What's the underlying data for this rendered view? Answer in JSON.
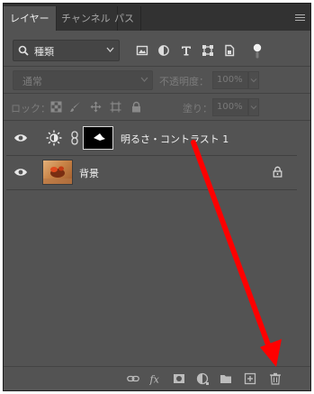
{
  "tabs": [
    {
      "label": "レイヤー",
      "active": true
    },
    {
      "label": "チャンネル",
      "active": false
    },
    {
      "label": "パス",
      "active": false
    }
  ],
  "filter": {
    "kind_label": "種類",
    "icons": [
      "image-filter-icon",
      "adjustment-filter-icon",
      "text-filter-icon",
      "shape-filter-icon",
      "smart-object-filter-icon",
      "filter-toggle-icon"
    ]
  },
  "blend": {
    "mode": "通常",
    "opacity_label": "不透明度：",
    "opacity_value": "100%"
  },
  "lock": {
    "label": "ロック：",
    "fill_label": "塗り：",
    "fill_value": "100%"
  },
  "layers": [
    {
      "name": "明るさ・コントラスト 1",
      "type": "adjustment",
      "visible": true
    },
    {
      "name": "背景",
      "type": "background",
      "visible": true,
      "locked": true
    }
  ],
  "footer_icons": [
    "link-layers-icon",
    "fx-icon",
    "add-mask-icon",
    "new-adjustment-icon",
    "new-group-icon",
    "new-layer-icon",
    "delete-layer-icon"
  ],
  "colors": {
    "panel_bg": "#535353",
    "tabbar_bg": "#323232",
    "annotation_arrow": "#ff0000"
  }
}
